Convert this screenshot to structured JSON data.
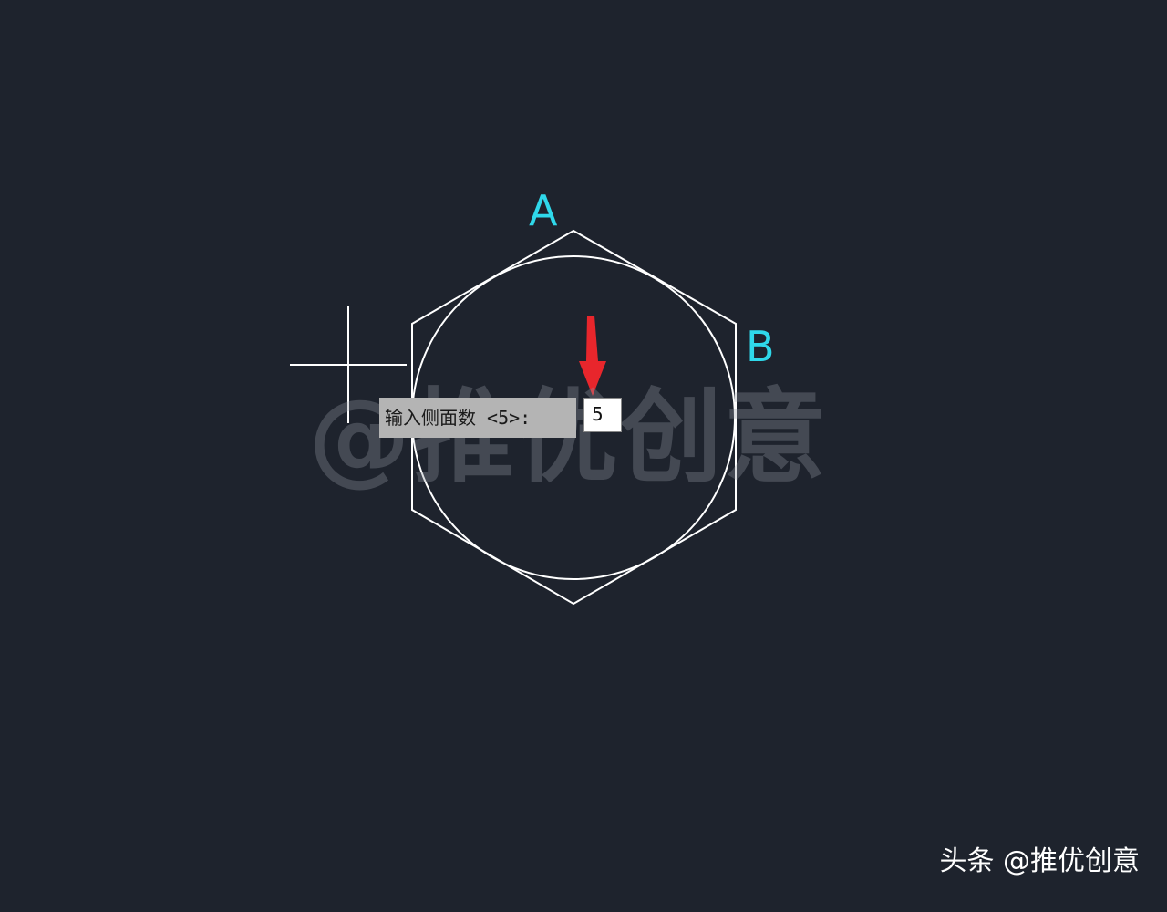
{
  "drawing": {
    "vertex_labels": {
      "a": "A",
      "b": "B"
    },
    "colors": {
      "background": "#1e232d",
      "geometry": "#ffffff",
      "labels": "#2fd8ea",
      "arrow": "#e8262c"
    },
    "icons": {
      "crosshair": "crosshair-cursor-icon",
      "arrow": "red-arrow-down-icon"
    }
  },
  "command_prompt": {
    "label": "输入侧面数 <5>:",
    "input_value": "5"
  },
  "watermark": "@推优创意",
  "footer": {
    "credit": "头条 @推优创意"
  }
}
